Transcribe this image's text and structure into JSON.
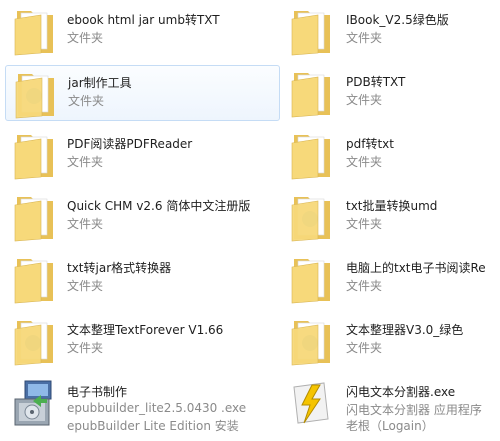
{
  "colors": {
    "folder_front": "#f7d97a",
    "folder_back": "#e8c157",
    "paper": "#ffffff",
    "selection_border": "#c5dcf5",
    "selection_fill": "#eef5fd",
    "label": "#1e1e1e",
    "secondary": "#8a8a8a"
  },
  "items": [
    {
      "name": "ebook html jar umb转TXT",
      "type": "文件夹",
      "icon": "folder-icon"
    },
    {
      "name": "IBook_V2.5绿色版",
      "type": "文件夹",
      "icon": "folder-icon"
    },
    {
      "name": "jar制作工具",
      "type": "文件夹",
      "icon": "folder-icon",
      "selected": true
    },
    {
      "name": "PDB转TXT",
      "type": "文件夹",
      "icon": "folder-icon"
    },
    {
      "name": "PDF阅读器PDFReader",
      "type": "文件夹",
      "icon": "folder-icon"
    },
    {
      "name": "pdf转txt",
      "type": "文件夹",
      "icon": "folder-icon"
    },
    {
      "name": "Quick CHM v2.6 简体中文注册版",
      "type": "文件夹",
      "icon": "folder-icon"
    },
    {
      "name": "txt批量转换umd",
      "type": "文件夹",
      "icon": "folder-icon"
    },
    {
      "name": "txt转jar格式转换器",
      "type": "文件夹",
      "icon": "folder-icon"
    },
    {
      "name": "电脑上的txt电子书阅读Re",
      "type": "文件夹",
      "icon": "folder-icon"
    },
    {
      "name": "文本整理TextForever V1.66",
      "type": "文件夹",
      "icon": "folder-icon"
    },
    {
      "name": "文本整理器V3.0_绿色",
      "type": "文件夹",
      "icon": "folder-icon"
    },
    {
      "name": "电子书制作",
      "type": "epubbuilder_lite2.5.0430 .exe",
      "type2": "epubBuilder Lite Edition 安装",
      "icon": "installer-icon"
    },
    {
      "name": "闪电文本分割器.exe",
      "type": "闪电文本分割器 应用程序",
      "type2": "老根（Logain）",
      "icon": "lightning-app-icon"
    }
  ]
}
